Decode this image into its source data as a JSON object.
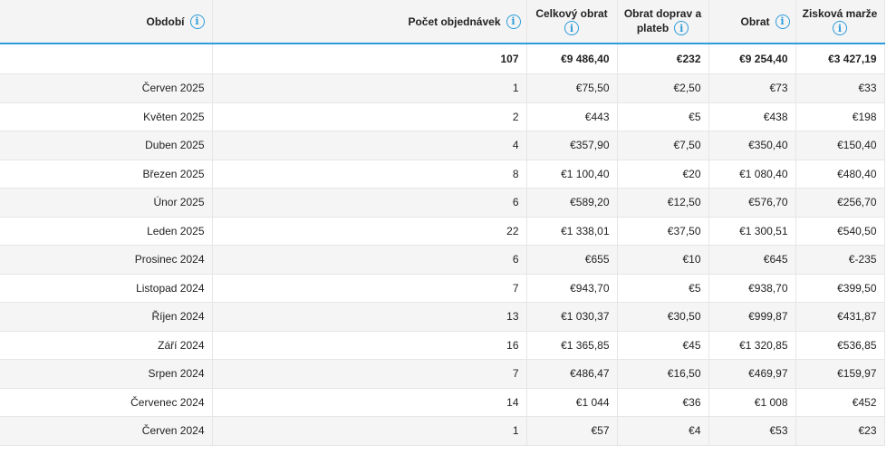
{
  "headers": {
    "period": "Období",
    "orders": "Počet objednávek",
    "total_revenue": "Celkový obrat",
    "shipping_line1": "Obrat doprav a",
    "shipping_line2": "plateb",
    "revenue": "Obrat",
    "margin": "Zisková marže"
  },
  "info_glyph": "i",
  "total": {
    "orders": "107",
    "total_revenue": "€9 486,40",
    "shipping": "€232",
    "revenue": "€9 254,40",
    "margin": "€3 427,19"
  },
  "rows": [
    {
      "period": "Červen 2025",
      "orders": "1",
      "total_revenue": "€75,50",
      "shipping": "€2,50",
      "revenue": "€73",
      "margin": "€33"
    },
    {
      "period": "Květen 2025",
      "orders": "2",
      "total_revenue": "€443",
      "shipping": "€5",
      "revenue": "€438",
      "margin": "€198"
    },
    {
      "period": "Duben 2025",
      "orders": "4",
      "total_revenue": "€357,90",
      "shipping": "€7,50",
      "revenue": "€350,40",
      "margin": "€150,40"
    },
    {
      "period": "Březen 2025",
      "orders": "8",
      "total_revenue": "€1 100,40",
      "shipping": "€20",
      "revenue": "€1 080,40",
      "margin": "€480,40"
    },
    {
      "period": "Únor 2025",
      "orders": "6",
      "total_revenue": "€589,20",
      "shipping": "€12,50",
      "revenue": "€576,70",
      "margin": "€256,70"
    },
    {
      "period": "Leden 2025",
      "orders": "22",
      "total_revenue": "€1 338,01",
      "shipping": "€37,50",
      "revenue": "€1 300,51",
      "margin": "€540,50"
    },
    {
      "period": "Prosinec 2024",
      "orders": "6",
      "total_revenue": "€655",
      "shipping": "€10",
      "revenue": "€645",
      "margin": "€-235"
    },
    {
      "period": "Listopad 2024",
      "orders": "7",
      "total_revenue": "€943,70",
      "shipping": "€5",
      "revenue": "€938,70",
      "margin": "€399,50"
    },
    {
      "period": "Říjen 2024",
      "orders": "13",
      "total_revenue": "€1 030,37",
      "shipping": "€30,50",
      "revenue": "€999,87",
      "margin": "€431,87"
    },
    {
      "period": "Září 2024",
      "orders": "16",
      "total_revenue": "€1 365,85",
      "shipping": "€45",
      "revenue": "€1 320,85",
      "margin": "€536,85"
    },
    {
      "period": "Srpen 2024",
      "orders": "7",
      "total_revenue": "€486,47",
      "shipping": "€16,50",
      "revenue": "€469,97",
      "margin": "€159,97"
    },
    {
      "period": "Červenec 2024",
      "orders": "14",
      "total_revenue": "€1 044",
      "shipping": "€36",
      "revenue": "€1 008",
      "margin": "€452"
    },
    {
      "period": "Červen 2024",
      "orders": "1",
      "total_revenue": "€57",
      "shipping": "€4",
      "revenue": "€53",
      "margin": "€23"
    }
  ],
  "colors": {
    "accent": "#2d9cdb",
    "header_bg": "#f4f4f4",
    "stripe_bg": "#f5f5f5"
  }
}
